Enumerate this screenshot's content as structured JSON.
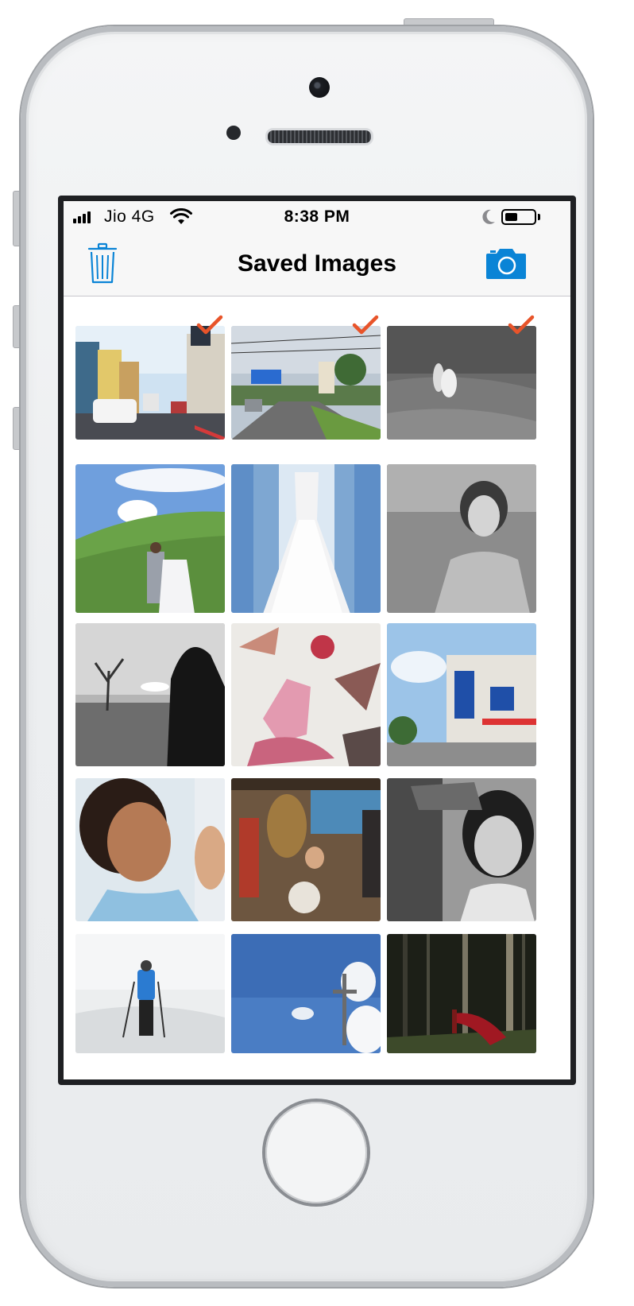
{
  "status_bar": {
    "carrier": "Jio 4G",
    "time": "8:38 PM",
    "battery_level": 0.45
  },
  "nav": {
    "title": "Saved Images",
    "left_icon": "trash-icon",
    "right_icon": "camera-icon"
  },
  "colors": {
    "accent": "#0a84d6",
    "check": "#e8542a",
    "bar_bg": "#f7f7f7"
  },
  "images": [
    {
      "scene": "street-buildings",
      "selected": true
    },
    {
      "scene": "road-billboard",
      "selected": true
    },
    {
      "scene": "couple-field-bw",
      "selected": true
    },
    {
      "scene": "couple-hill",
      "selected": false
    },
    {
      "scene": "wedding-dress",
      "selected": false
    },
    {
      "scene": "woman-portrait-bw",
      "selected": false
    },
    {
      "scene": "hooded-figure-bw",
      "selected": false
    },
    {
      "scene": "abstract-art",
      "selected": false
    },
    {
      "scene": "shops-street",
      "selected": false
    },
    {
      "scene": "woman-smiling",
      "selected": false
    },
    {
      "scene": "band-drums",
      "selected": false
    },
    {
      "scene": "girl-bw",
      "selected": false
    },
    {
      "scene": "skier-snow",
      "selected": false
    },
    {
      "scene": "cross-sky",
      "selected": false
    },
    {
      "scene": "forest-red-dress",
      "selected": false
    }
  ]
}
